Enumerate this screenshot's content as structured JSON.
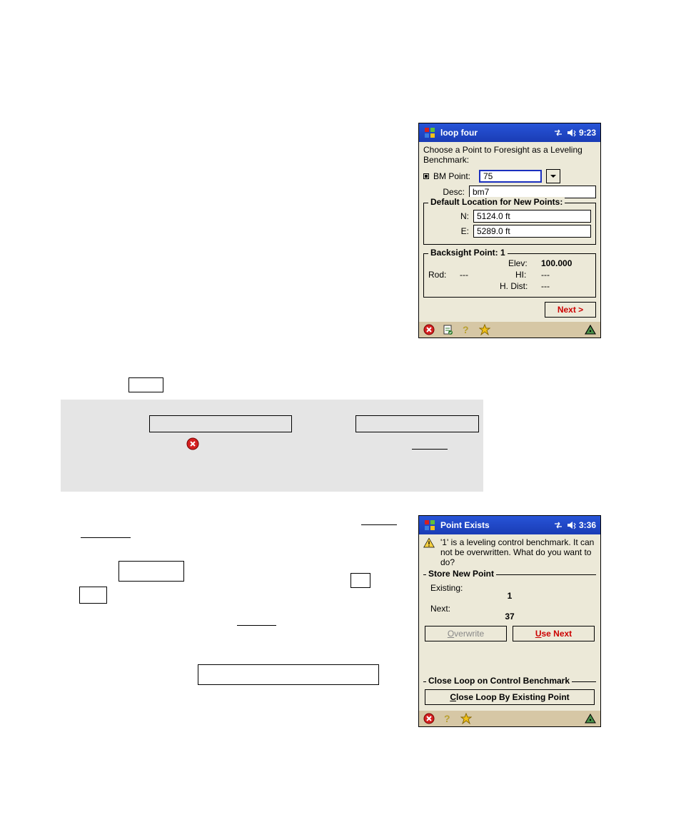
{
  "window_top": {
    "title": "loop four",
    "time": "9:23",
    "instruction": "Choose a Point to Foresight as a Leveling Benchmark:",
    "bm_point_label": "BM Point:",
    "bm_point_value": "75",
    "desc_label": "Desc:",
    "desc_value": "bm7",
    "default_loc_legend": "Default Location for New Points:",
    "n_label": "N:",
    "n_value": "5124.0 ft",
    "e_label": "E:",
    "e_value": "5289.0 ft",
    "backsight_legend": "Backsight Point: 1",
    "elev_label": "Elev:",
    "elev_value": "100.000",
    "rod_label": "Rod:",
    "rod_value": "---",
    "hi_label": "HI:",
    "hi_value": "---",
    "hdist_label": "H. Dist:",
    "hdist_value": "---",
    "next_btn": "Next >"
  },
  "window_bottom": {
    "title": "Point Exists",
    "time": "3:36",
    "warn_text": "'1' is a leveling control benchmark. It can not be overwritten. What do you want to do?",
    "store_legend": "Store New Point",
    "existing_label": "Existing:",
    "existing_value": "1",
    "next_label": "Next:",
    "next_value": "37",
    "overwrite_btn_pre": "O",
    "overwrite_btn_rest": "verwrite",
    "usenext_btn_pre": "U",
    "usenext_btn_rest": "se Next",
    "close_legend": "Close Loop on Control Benchmark",
    "close_btn_pre": "C",
    "close_btn_rest": "lose Loop By Existing Point"
  },
  "icons": {
    "close": "close-circle-icon",
    "notes": "clipboard-icon",
    "help": "help-icon",
    "star": "star-icon",
    "tri": "hazard-triangle-icon"
  }
}
